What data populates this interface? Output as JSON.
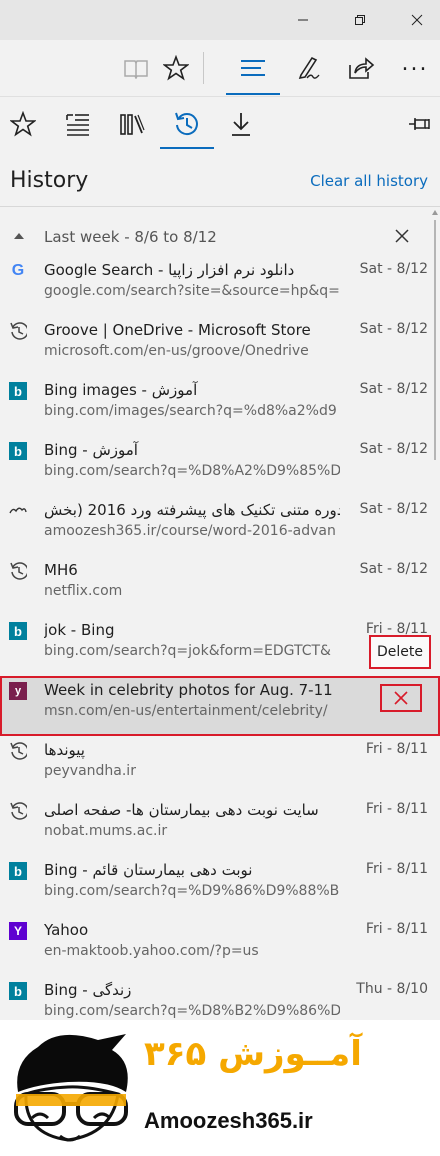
{
  "window": {
    "controls": [
      "minimize-icon",
      "restore-icon",
      "close-icon"
    ]
  },
  "toolbar": {
    "icons": [
      "reading-view-icon",
      "favorites-star-icon",
      "hub-icon",
      "web-note-icon",
      "share-icon",
      "more-icon"
    ],
    "more_label": "..."
  },
  "hub_tabs": {
    "icons": [
      "favorites-icon",
      "reading-list-icon",
      "books-icon",
      "history-icon",
      "downloads-icon",
      "pin-icon"
    ],
    "active": "history"
  },
  "history": {
    "heading": "History",
    "clear_label": "Clear all history",
    "group_label": "Last week - 8/6 to 8/12",
    "items": [
      {
        "icon": "google",
        "title": "Google Search - دانلود نرم افزار زاپیا",
        "url": "google.com/search?site=&source=hp&q=",
        "date": "Sat - 8/12"
      },
      {
        "icon": "history",
        "title": "Groove | OneDrive - Microsoft Store",
        "url": "microsoft.com/en-us/groove/Onedrive",
        "date": "Sat - 8/12"
      },
      {
        "icon": "bing",
        "title": "Bing images - آموزش",
        "url": "bing.com/images/search?q=%d8%a2%d9",
        "date": "Sat - 8/12"
      },
      {
        "icon": "bing",
        "title": "Bing - آموزش",
        "url": "bing.com/search?q=%D8%A2%D9%85%D",
        "date": "Sat - 8/12"
      },
      {
        "icon": "site",
        "title": "دوره متنی تکنیک های پیشرفته ورد 2016 (بخش",
        "url": "amoozesh365.ir/course/word-2016-advan",
        "date": "Sat - 8/12"
      },
      {
        "icon": "history",
        "title": "MH6",
        "url": "netflix.com",
        "date": "Sat - 8/12"
      },
      {
        "icon": "bing",
        "title": "jok - Bing",
        "url": "bing.com/search?q=jok&form=EDGTCT&",
        "date": "Fri - 8/11"
      },
      {
        "icon": "msn",
        "title": "Week in celebrity photos for Aug. 7-11",
        "url": "msn.com/en-us/entertainment/celebrity/",
        "date": ""
      },
      {
        "icon": "history",
        "title": "پیوندها",
        "url": "peyvandha.ir",
        "date": "Fri - 8/11"
      },
      {
        "icon": "history",
        "title": "سایت نوبت دهی بیمارستان ها- صفحه اصلی",
        "url": "nobat.mums.ac.ir",
        "date": "Fri - 8/11"
      },
      {
        "icon": "bing",
        "title": "Bing - نوبت دهی بیمارستان قائم",
        "url": "bing.com/search?q=%D9%86%D9%88%B",
        "date": "Fri - 8/11"
      },
      {
        "icon": "yahoo",
        "title": "Yahoo",
        "url": "en-maktoob.yahoo.com/?p=us",
        "date": "Fri - 8/11"
      },
      {
        "icon": "bing",
        "title": "Bing - زندگی",
        "url": "bing.com/search?q=%D8%B2%D9%86%D",
        "date": "Thu - 8/10"
      }
    ],
    "delete_label": "Delete"
  },
  "watermark": {
    "persian": "آمــوزش ۳۶۵",
    "english": "Amoozesh365.ir"
  },
  "colors": {
    "accent": "#0b6cbd",
    "highlight_border": "#d81b2a",
    "logo_orange": "#f5a800"
  }
}
